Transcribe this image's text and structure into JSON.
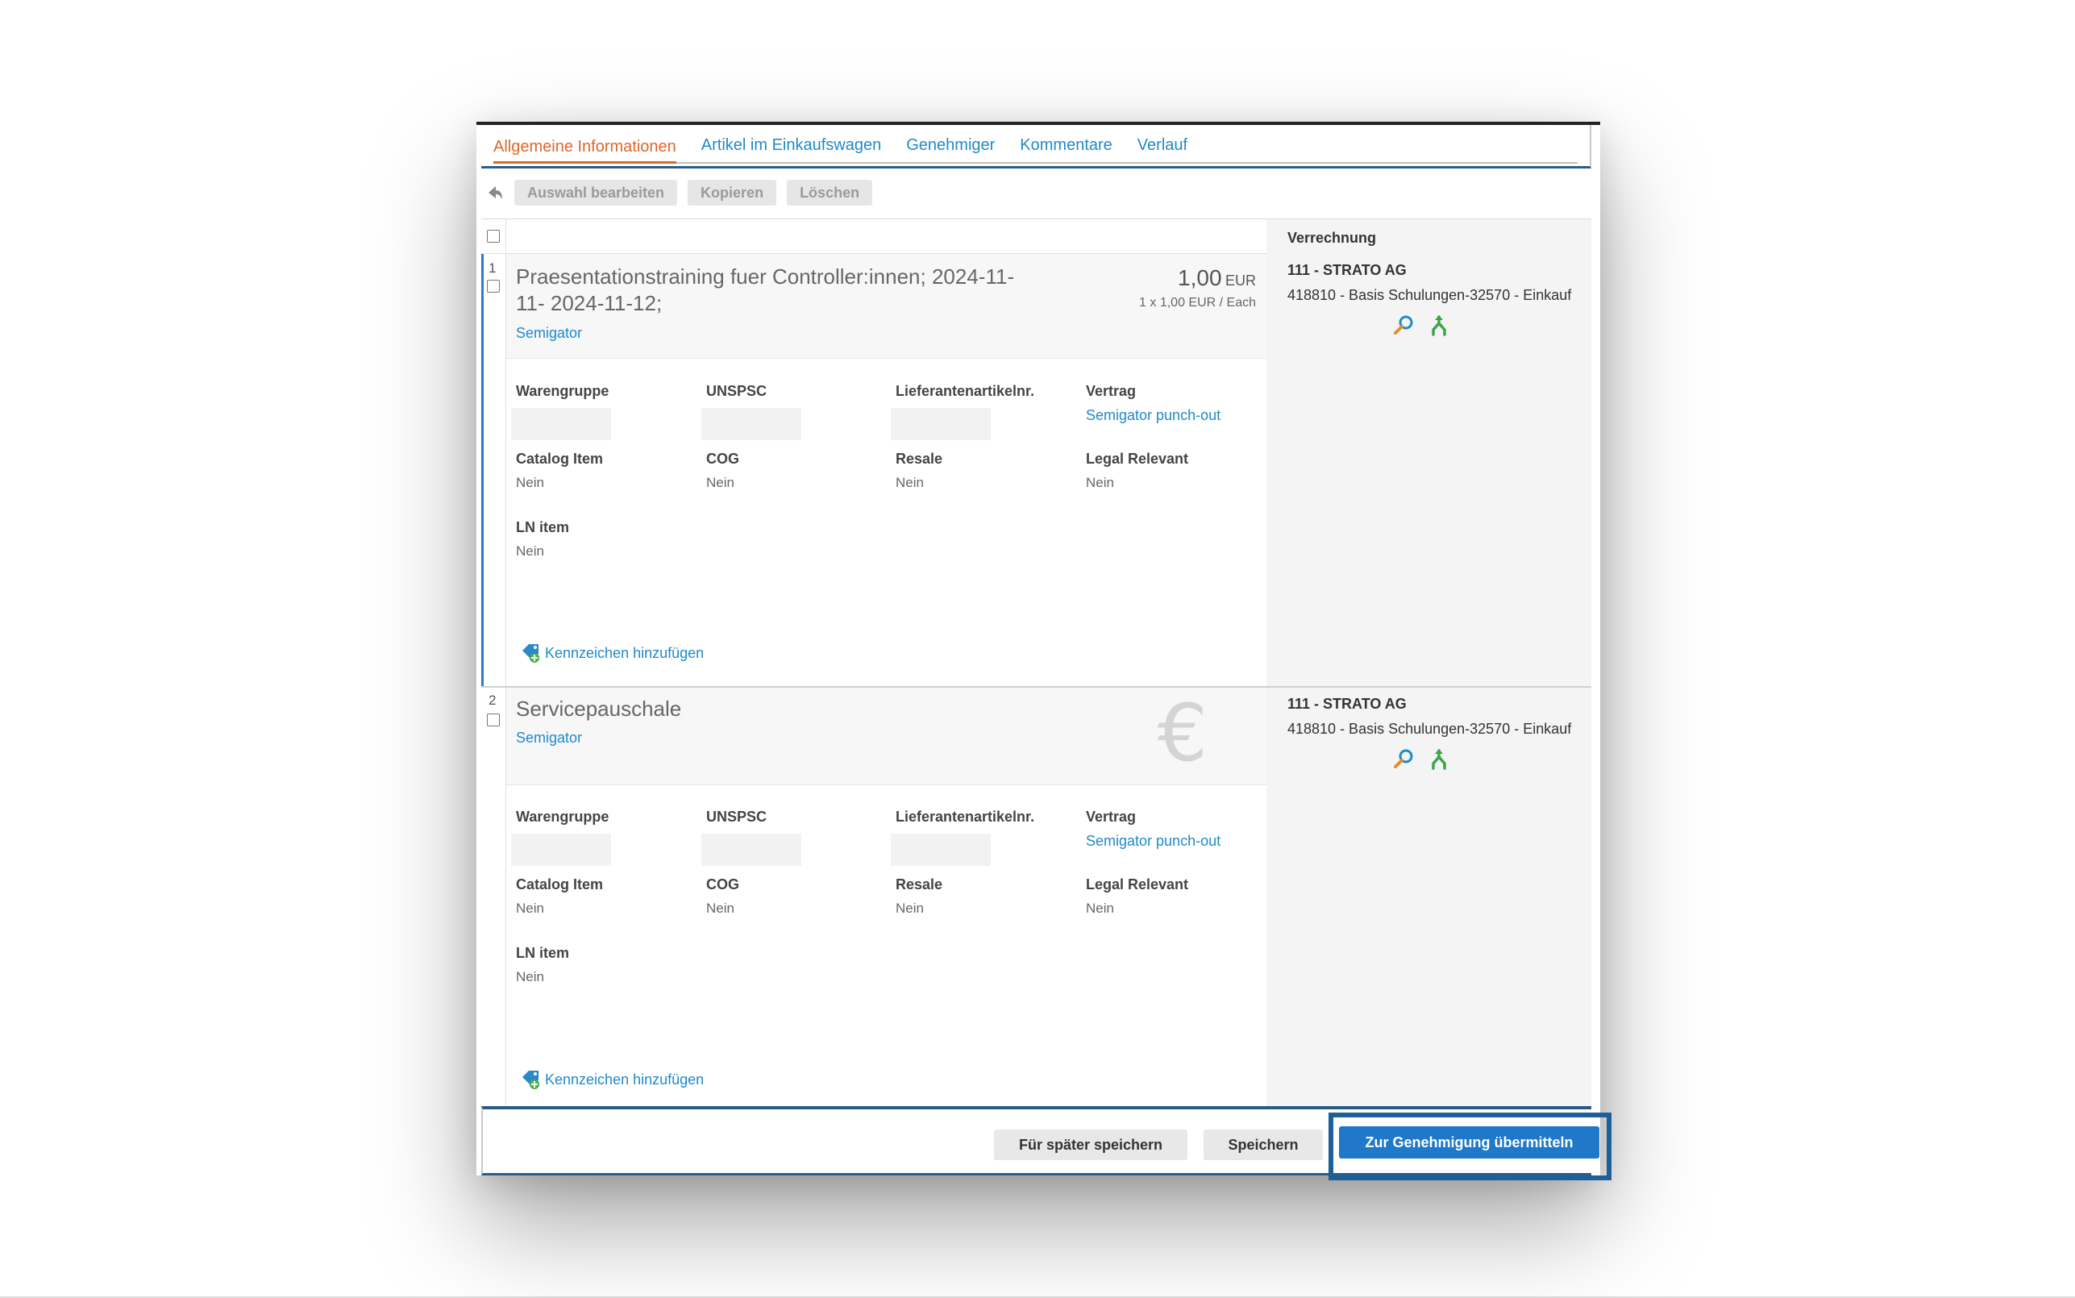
{
  "tabs": [
    {
      "label": "Allgemeine Informationen",
      "active": true
    },
    {
      "label": "Artikel im Einkaufswagen"
    },
    {
      "label": "Genehmiger"
    },
    {
      "label": "Kommentare"
    },
    {
      "label": "Verlauf"
    }
  ],
  "toolbar": {
    "back_icon": "back-arrow-icon",
    "edit_label": "Auswahl bearbeiten",
    "copy_label": "Kopieren",
    "delete_label": "Löschen"
  },
  "grid": {
    "accounting_header": "Verrechnung"
  },
  "items": [
    {
      "number": "1",
      "title_line1": "Praesentationstraining fuer Controller:innen; 2024-11-",
      "title_line2": "11- 2024-11-12;",
      "supplier": "Semigator",
      "price": "1,00",
      "currency": "EUR",
      "price_detail": "1 x 1,00 EUR / Each",
      "fields": {
        "warengruppe": "Warengruppe",
        "unspsc": "UNSPSC",
        "lieferantenartikelnr": "Lieferantenartikelnr.",
        "vertrag": "Vertrag",
        "vertrag_value": "Semigator punch-out",
        "catalog_item": "Catalog Item",
        "catalog_item_value": "Nein",
        "cog": "COG",
        "cog_value": "Nein",
        "resale": "Resale",
        "resale_value": "Nein",
        "legal_relevant": "Legal Relevant",
        "legal_relevant_value": "Nein",
        "ln_item": "LN item",
        "ln_item_value": "Nein"
      },
      "tag_link": "Kennzeichen hinzufügen",
      "accounting": {
        "company": "111 - STRATO AG",
        "account": "418810 - Basis Schulungen-32570 - Einkauf"
      }
    },
    {
      "number": "2",
      "title_line1": "Servicepauschale",
      "supplier": "Semigator",
      "fields": {
        "warengruppe": "Warengruppe",
        "unspsc": "UNSPSC",
        "lieferantenartikelnr": "Lieferantenartikelnr.",
        "vertrag": "Vertrag",
        "vertrag_value": "Semigator punch-out",
        "catalog_item": "Catalog Item",
        "catalog_item_value": "Nein",
        "cog": "COG",
        "cog_value": "Nein",
        "resale": "Resale",
        "resale_value": "Nein",
        "legal_relevant": "Legal Relevant",
        "legal_relevant_value": "Nein",
        "ln_item": "LN item",
        "ln_item_value": "Nein"
      },
      "tag_link": "Kennzeichen hinzufügen",
      "accounting": {
        "company": "111 - STRATO AG",
        "account": "418810 - Basis Schulungen-32570 - Einkauf"
      }
    }
  ],
  "footer": {
    "save_later_label": "Für später speichern",
    "save_label": "Speichern",
    "submit_label": "Zur Genehmigung übermitteln"
  },
  "colors": {
    "accent_link": "#1f8ac8",
    "active_tab": "#e0662b",
    "submit_button": "#1f78c8",
    "highlight_frame": "#1f5f99"
  }
}
